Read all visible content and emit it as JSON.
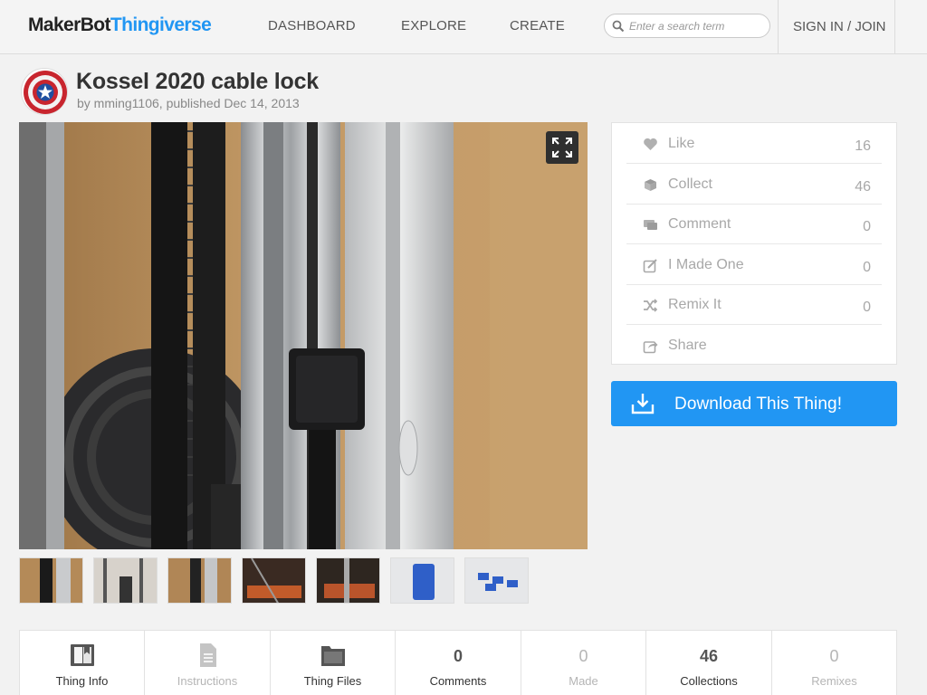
{
  "header": {
    "logo_part1": "MakerBot",
    "logo_part2": "Thingiverse",
    "nav": [
      "DASHBOARD",
      "EXPLORE",
      "CREATE"
    ],
    "search_placeholder": "Enter a search term",
    "sign_in": "SIGN IN / JOIN"
  },
  "thing": {
    "title": "Kossel 2020 cable lock",
    "byline": "by mming1106, published Dec 14, 2013"
  },
  "stats": [
    {
      "label": "Like",
      "count": "16",
      "icon": "heart-icon"
    },
    {
      "label": "Collect",
      "count": "46",
      "icon": "collect-icon"
    },
    {
      "label": "Comment",
      "count": "0",
      "icon": "comment-icon"
    },
    {
      "label": "I Made One",
      "count": "0",
      "icon": "edit-icon"
    },
    {
      "label": "Remix It",
      "count": "0",
      "icon": "shuffle-icon"
    },
    {
      "label": "Share",
      "count": "",
      "icon": "share-icon"
    }
  ],
  "download_label": "Download This Thing!",
  "tabs": [
    {
      "label": "Thing Info",
      "icon": "book-icon",
      "count": ""
    },
    {
      "label": "Instructions",
      "icon": "document-icon",
      "count": ""
    },
    {
      "label": "Thing Files",
      "icon": "folder-icon",
      "count": ""
    },
    {
      "label": "Comments",
      "count": "0"
    },
    {
      "label": "Made",
      "count": "0"
    },
    {
      "label": "Collections",
      "count": "46"
    },
    {
      "label": "Remixes",
      "count": "0"
    }
  ],
  "colors": {
    "brand_blue": "#2196f3",
    "header_bg": "#f4f4f4",
    "page_bg": "#f2f2f2"
  }
}
